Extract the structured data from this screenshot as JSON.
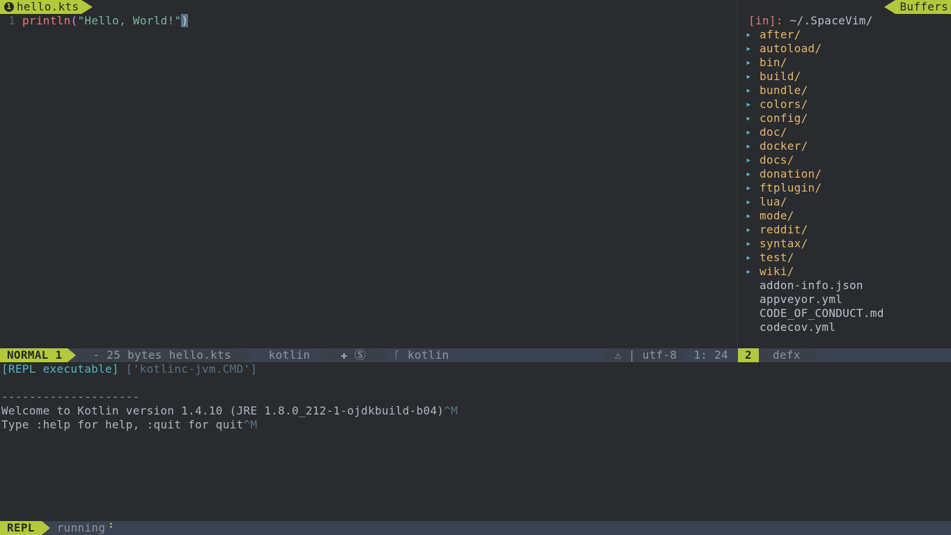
{
  "colors": {
    "accent": "#b3c93d",
    "bg": "#292b2e"
  },
  "tabs": {
    "left_index": "1",
    "left_label": "hello.kts",
    "right_label": "Buffers"
  },
  "code": {
    "line_no": "1",
    "fn": "println",
    "open_paren": "(",
    "string": "\"Hello, World!\"",
    "close_paren": ")"
  },
  "tree": {
    "in_label": "[in]:",
    "in_path": "~/.SpaceVim/",
    "items": [
      {
        "type": "dir",
        "name": "after/"
      },
      {
        "type": "dir",
        "name": "autoload/"
      },
      {
        "type": "dir",
        "name": "bin/"
      },
      {
        "type": "dir",
        "name": "build/"
      },
      {
        "type": "dir",
        "name": "bundle/"
      },
      {
        "type": "dir",
        "name": "colors/"
      },
      {
        "type": "dir",
        "name": "config/"
      },
      {
        "type": "dir",
        "name": "doc/"
      },
      {
        "type": "dir",
        "name": "docker/"
      },
      {
        "type": "dir",
        "name": "docs/"
      },
      {
        "type": "dir",
        "name": "donation/"
      },
      {
        "type": "dir",
        "name": "ftplugin/"
      },
      {
        "type": "dir",
        "name": "lua/"
      },
      {
        "type": "dir",
        "name": "mode/"
      },
      {
        "type": "dir",
        "name": "reddit/"
      },
      {
        "type": "dir",
        "name": "syntax/"
      },
      {
        "type": "dir",
        "name": "test/"
      },
      {
        "type": "dir",
        "name": "wiki/"
      },
      {
        "type": "file",
        "name": "addon-info.json"
      },
      {
        "type": "file",
        "name": "appveyor.yml"
      },
      {
        "type": "file",
        "name": "CODE_OF_CONDUCT.md"
      },
      {
        "type": "file",
        "name": "codecov.yml"
      }
    ]
  },
  "status_main": {
    "mode": "NORMAL 1",
    "file_info": " - 25 bytes hello.kts ",
    "filetype": " kotlin ",
    "icons": " ✚ Ⓢ ",
    "branch_glyph": "ᚴ",
    "branch": " kotlin",
    "lint_glyph": "⚠",
    "divider": " | ",
    "encoding": "utf-8",
    "position": "1: 24"
  },
  "status_tree": {
    "index": "2",
    "name": "defx"
  },
  "repl": {
    "label": "[REPL executable]",
    "cmd": "['kotlinc-jvm.CMD']",
    "dashes": "--------------------",
    "welcome": "Welcome to Kotlin version 1.4.10 (JRE 1.8.0_212-1-ojdkbuild-b04)",
    "welcome_suffix": "^M",
    "help": "Type :help for help, :quit for quit",
    "help_suffix": "^M"
  },
  "status_repl": {
    "mode": "REPL",
    "state": "running",
    "spinner": "⠘"
  }
}
